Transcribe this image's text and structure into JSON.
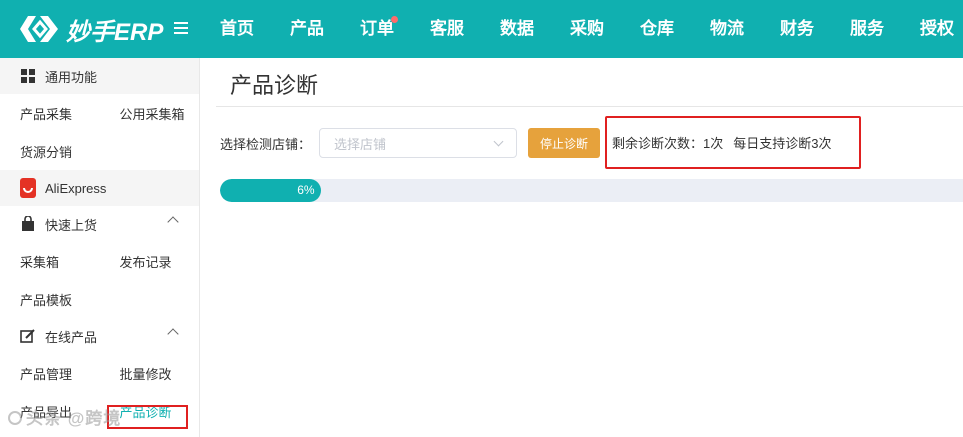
{
  "header": {
    "logo_text": "妙手ERP",
    "nav": [
      {
        "label": "首页",
        "dot": false
      },
      {
        "label": "产品",
        "dot": false
      },
      {
        "label": "订单",
        "dot": true
      },
      {
        "label": "客服",
        "dot": false
      },
      {
        "label": "数据",
        "dot": false
      },
      {
        "label": "采购",
        "dot": false
      },
      {
        "label": "仓库",
        "dot": false
      },
      {
        "label": "物流",
        "dot": false
      },
      {
        "label": "财务",
        "dot": false
      },
      {
        "label": "服务",
        "dot": false
      },
      {
        "label": "授权",
        "dot": false
      }
    ]
  },
  "sidebar": {
    "general": {
      "title": "通用功能",
      "items": [
        "产品采集",
        "公用采集箱",
        "货源分销"
      ]
    },
    "aliexpress": {
      "title": "AliExpress"
    },
    "quick_upload": {
      "title": "快速上货",
      "items": [
        "采集箱",
        "发布记录",
        "产品模板"
      ]
    },
    "online_products": {
      "title": "在线产品",
      "items": [
        "产品管理",
        "批量修改",
        "产品导出",
        "产品诊断"
      ]
    }
  },
  "main": {
    "title": "产品诊断",
    "filter_label": "选择检测店铺：",
    "store_placeholder": "选择店铺",
    "stop_button": "停止诊断",
    "remaining": "剩余诊断次数：1次",
    "daily": "每日支持诊断3次",
    "progress": {
      "value": 6,
      "label": "6%"
    }
  },
  "colors": {
    "brand": "#10b0b0",
    "warning": "#e6a23c",
    "highlight": "#e02020"
  },
  "watermark": "头条 @跨境"
}
